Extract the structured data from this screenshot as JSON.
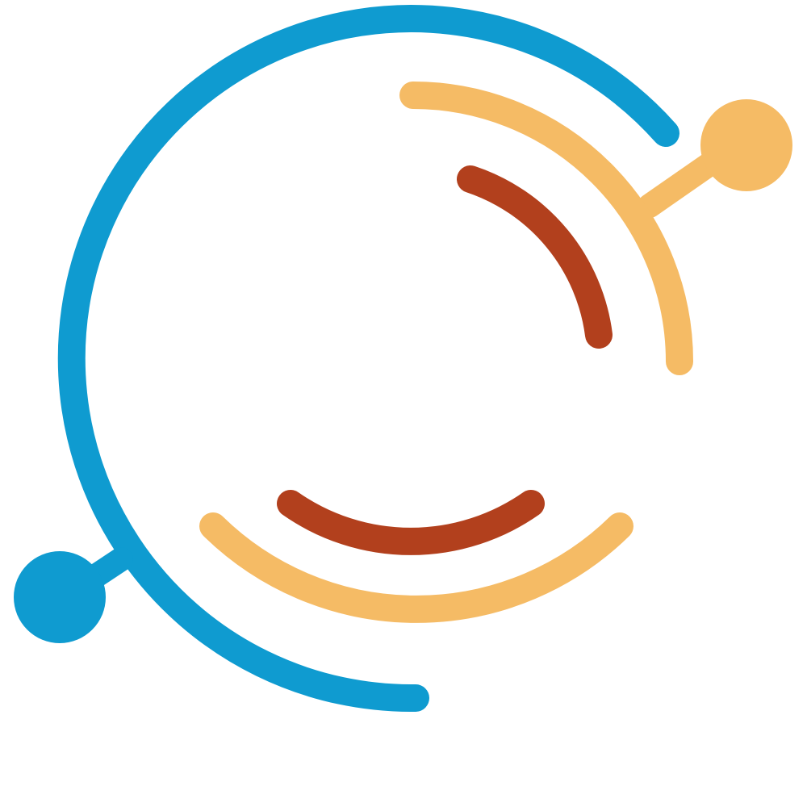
{
  "logo": {
    "elements": [
      "outer-arc",
      "outer-connector-top",
      "outer-node-top",
      "outer-connector-bottom",
      "outer-node-bottom",
      "middle-arc-top",
      "middle-arc-bottom",
      "inner-arc-top",
      "inner-arc-bottom"
    ]
  },
  "colors": {
    "background": "#ffffff",
    "primary_blue": "#0f9bd0",
    "accent_orange": "#f5bb65",
    "accent_rust": "#b2401d"
  }
}
